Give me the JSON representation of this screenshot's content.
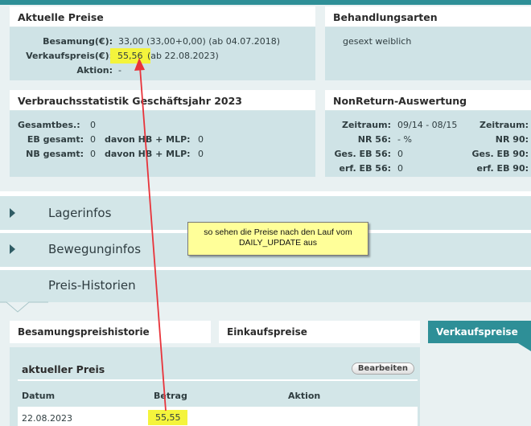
{
  "aktuelle_preise": {
    "title": "Aktuelle Preise",
    "besamung_label": "Besamung(€):",
    "besamung_value": "33,00 (33,00+0,00) (ab 04.07.2018)",
    "verkaufspreis_label": "Verkaufspreis(€):",
    "verkaufspreis_value": "55,56",
    "verkaufspreis_date": "(ab 22.08.2023)",
    "aktion_label": "Aktion:",
    "aktion_value": "-"
  },
  "behandlungsarten": {
    "title": "Behandlungsarten",
    "value": "gesext weiblich"
  },
  "verbrauchsstatistik": {
    "title": "Verbrauchsstatistik Geschäftsjahr 2023",
    "gesamtbes_label": "Gesamtbes.:",
    "gesamtbes_value": "0",
    "eb_label": "EB gesamt:",
    "eb_value": "0",
    "eb_davon_label": "davon HB + MLP:",
    "eb_davon_value": "0",
    "nb_label": "NB gesamt:",
    "nb_value": "0",
    "nb_davon_label": "davon HB + MLP:",
    "nb_davon_value": "0"
  },
  "nonreturn": {
    "title": "NonReturn-Auswertung",
    "zeitraum_label": "Zeitraum:",
    "zeitraum_value": "09/14 - 08/15",
    "nr56_label": "NR 56:",
    "nr56_value": "- %",
    "ges_eb56_label": "Ges. EB 56:",
    "ges_eb56_value": "0",
    "erf_eb56_label": "erf. EB 56:",
    "erf_eb56_value": "0",
    "zeitraum2_label": "Zeitraum:",
    "nr90_label": "NR 90:",
    "ges_eb90_label": "Ges. EB 90:",
    "erf_eb90_label": "erf. EB 90:"
  },
  "accordion": {
    "lagerinfos": "Lagerinfos",
    "bewegungsinfos": "Bewegunginfos",
    "preis_historien": "Preis-Historien"
  },
  "note": {
    "line1": "so sehen die Preise nach den Lauf vom",
    "line2": "DAILY_UPDATE aus"
  },
  "tabs": {
    "besamung": "Besamungspreishistorie",
    "einkauf": "Einkaufspreise",
    "verkauf": "Verkaufspreise"
  },
  "history": {
    "title": "aktueller Preis",
    "edit_button": "Bearbeiten",
    "col_datum": "Datum",
    "col_betrag": "Betrag",
    "col_aktion": "Aktion",
    "row_datum": "22.08.2023",
    "row_betrag": "55,55"
  },
  "colors": {
    "accent": "#2e8f97",
    "highlight": "#f4f43c",
    "arrow": "#e8333a"
  }
}
